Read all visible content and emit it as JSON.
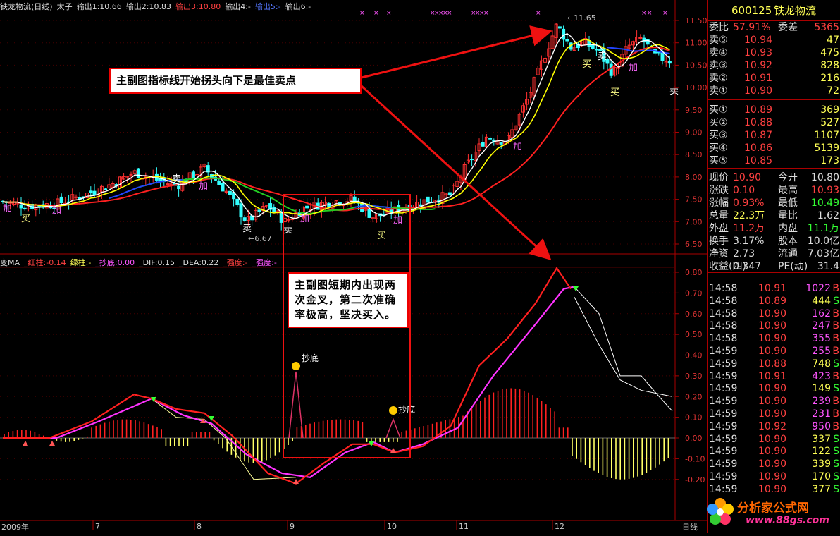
{
  "header": {
    "title": "铁龙物流(日线)",
    "period": "太子",
    "out1": "输出1:10.66",
    "out2": "输出2:10.83",
    "out3": "输出3:10.80",
    "out4": "输出4:-",
    "out5": "输出5:-",
    "out6": "输出6:-"
  },
  "indicator_header": {
    "name": "变MA",
    "red_bar": "_红柱:-0.14",
    "green_bar": "绿柱:-",
    "bottom": "_抄底:0.00",
    "dif": "_DIF:0.15",
    "dea": "_DEA:0.22",
    "strength1": "_强度:-",
    "strength2": "_强度:-"
  },
  "price_axis": [
    "11.50",
    "11.00",
    "10.50",
    "10.00",
    "9.50",
    "9.00",
    "8.50",
    "8.00",
    "7.50",
    "7.00",
    "6.50"
  ],
  "macd_axis": [
    "0.80",
    "0.70",
    "0.60",
    "0.50",
    "0.40",
    "0.30",
    "0.20",
    "0.10",
    "0.00",
    "-0.10",
    "-0.20"
  ],
  "annotations": {
    "high": "11.65",
    "low": "6.67",
    "buy": "买",
    "add": "加",
    "sell": "卖",
    "bottom": "抄底",
    "box1": "主副图指标线开始拐头向下是最佳卖点",
    "box2": "主副图短期内出现两次金叉，第二次准确率极高，坚决买入。"
  },
  "x_axis": {
    "year": "2009年",
    "months": [
      "7",
      "8",
      "9",
      "10",
      "11",
      "12"
    ],
    "period_label": "日线"
  },
  "quote": {
    "code": "600125",
    "name": "铁龙物流",
    "commission_ratio_label": "委比",
    "commission_ratio": "57.91%",
    "commission_diff_label": "委差",
    "commission_diff": "5365",
    "asks": [
      {
        "label": "卖⑤",
        "price": "10.94",
        "vol": "47"
      },
      {
        "label": "卖④",
        "price": "10.93",
        "vol": "475"
      },
      {
        "label": "卖③",
        "price": "10.92",
        "vol": "828"
      },
      {
        "label": "卖②",
        "price": "10.91",
        "vol": "216"
      },
      {
        "label": "卖①",
        "price": "10.90",
        "vol": "72"
      }
    ],
    "bids": [
      {
        "label": "买①",
        "price": "10.89",
        "vol": "369"
      },
      {
        "label": "买②",
        "price": "10.88",
        "vol": "527"
      },
      {
        "label": "买③",
        "price": "10.87",
        "vol": "1107"
      },
      {
        "label": "买④",
        "price": "10.86",
        "vol": "5139"
      },
      {
        "label": "买⑤",
        "price": "10.85",
        "vol": "173"
      }
    ],
    "stats": [
      {
        "l1": "现价",
        "v1": "10.90",
        "l2": "今开",
        "v2": "10.80"
      },
      {
        "l1": "涨跌",
        "v1": "0.10",
        "l2": "最高",
        "v2": "10.93"
      },
      {
        "l1": "涨幅",
        "v1": "0.93%",
        "l2": "最低",
        "v2": "10.49"
      },
      {
        "l1": "总量",
        "v1": "22.3万",
        "l2": "量比",
        "v2": "1.62"
      },
      {
        "l1": "外盘",
        "v1": "11.2万",
        "l2": "内盘",
        "v2": "11.1万"
      },
      {
        "l1": "换手",
        "v1": "3.17%",
        "l2": "股本",
        "v2": "10.0亿"
      },
      {
        "l1": "净资",
        "v1": "2.73",
        "l2": "流通",
        "v2": "7.03亿"
      },
      {
        "l1": "收益(四)",
        "v1": "0.347",
        "l2": "PE(动)",
        "v2": "31.4"
      }
    ],
    "ticks": [
      {
        "t": "14:58",
        "p": "10.91",
        "v": "1022",
        "s": "B"
      },
      {
        "t": "14:58",
        "p": "10.89",
        "v": "444",
        "s": "S"
      },
      {
        "t": "14:58",
        "p": "10.90",
        "v": "162",
        "s": "B"
      },
      {
        "t": "14:58",
        "p": "10.90",
        "v": "247",
        "s": "B"
      },
      {
        "t": "14:58",
        "p": "10.90",
        "v": "355",
        "s": "B"
      },
      {
        "t": "14:59",
        "p": "10.90",
        "v": "255",
        "s": "B"
      },
      {
        "t": "14:59",
        "p": "10.88",
        "v": "748",
        "s": "S"
      },
      {
        "t": "14:59",
        "p": "10.91",
        "v": "423",
        "s": "B"
      },
      {
        "t": "14:59",
        "p": "10.90",
        "v": "149",
        "s": "S"
      },
      {
        "t": "14:59",
        "p": "10.90",
        "v": "239",
        "s": "B"
      },
      {
        "t": "14:59",
        "p": "10.90",
        "v": "231",
        "s": "B"
      },
      {
        "t": "14:59",
        "p": "10.92",
        "v": "950",
        "s": "B"
      },
      {
        "t": "14:59",
        "p": "10.90",
        "v": "337",
        "s": "S"
      },
      {
        "t": "14:59",
        "p": "10.90",
        "v": "122",
        "s": "S"
      },
      {
        "t": "14:59",
        "p": "10.90",
        "v": "339",
        "s": "S"
      },
      {
        "t": "14:59",
        "p": "10.90",
        "v": "170",
        "s": "S"
      },
      {
        "t": "14:59",
        "p": "10.90",
        "v": "377",
        "s": "S"
      }
    ]
  },
  "watermark": {
    "brand": "分析家公式网",
    "url": "www.88gs.com"
  },
  "colors": {
    "up": "#ff3030",
    "down": "#33ffff",
    "ma_white": "#ffffff",
    "ma_yellow": "#ffff00",
    "ma_red": "#ff2020",
    "ma_green": "#22cc22",
    "ma_blue": "#2244ff",
    "dea": "#ff33ff",
    "dif": "#ff2020"
  }
}
